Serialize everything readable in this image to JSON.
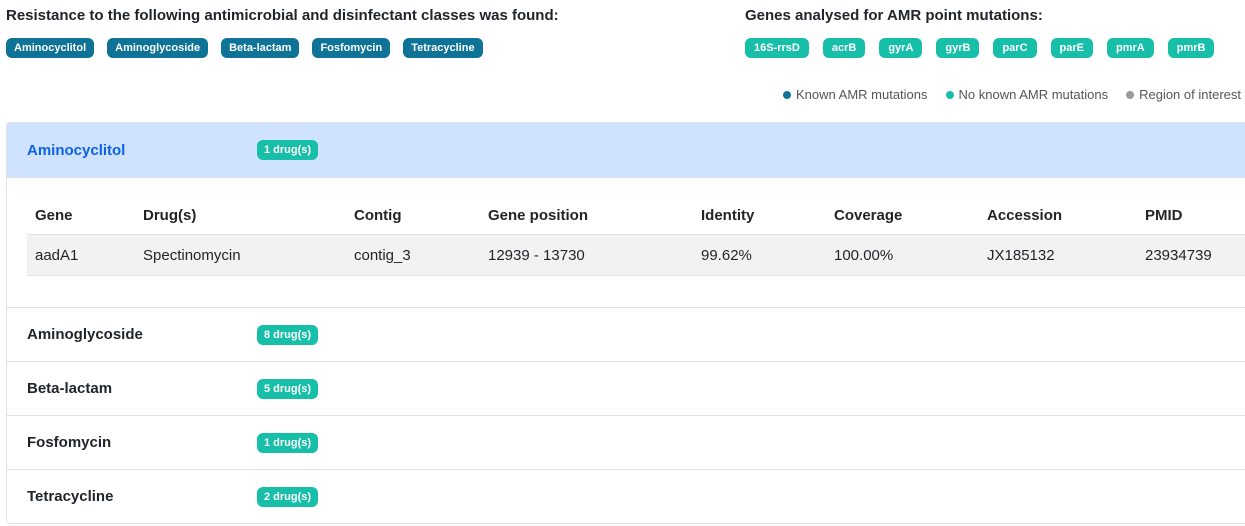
{
  "resistance": {
    "heading": "Resistance to the following antimicrobial and disinfectant classes was found:",
    "classes": [
      "Aminocyclitol",
      "Aminoglycoside",
      "Beta-lactam",
      "Fosfomycin",
      "Tetracycline"
    ]
  },
  "point_mutations": {
    "heading": "Genes analysed for AMR point mutations:",
    "genes": [
      "16S-rrsD",
      "acrB",
      "gyrA",
      "gyrB",
      "parC",
      "parE",
      "pmrA",
      "pmrB"
    ]
  },
  "legend": {
    "items": [
      {
        "label": "Known AMR mutations",
        "color": "#0e7396"
      },
      {
        "label": "No known AMR mutations",
        "color": "#17bfa9"
      },
      {
        "label": "Region of interest",
        "color": "#999999"
      }
    ]
  },
  "accordion": {
    "open": {
      "title": "Aminocyclitol",
      "badge": "1 drug(s)",
      "table": {
        "headers": [
          "Gene",
          "Drug(s)",
          "Contig",
          "Gene position",
          "Identity",
          "Coverage",
          "Accession",
          "PMID"
        ],
        "rows": [
          [
            "aadA1",
            "Spectinomycin",
            "contig_3",
            "12939 - 13730",
            "99.62%",
            "100.00%",
            "JX185132",
            "23934739"
          ]
        ]
      }
    },
    "items": [
      {
        "title": "Aminoglycoside",
        "badge": "8 drug(s)"
      },
      {
        "title": "Beta-lactam",
        "badge": "5 drug(s)"
      },
      {
        "title": "Fosfomycin",
        "badge": "1 drug(s)"
      },
      {
        "title": "Tetracycline",
        "badge": "2 drug(s)"
      }
    ]
  },
  "colors": {
    "class_badge": "#0e7396",
    "gene_badge": "#17bfa9",
    "open_header_bg": "#cfe2ff",
    "open_header_text": "#0c63e4"
  }
}
